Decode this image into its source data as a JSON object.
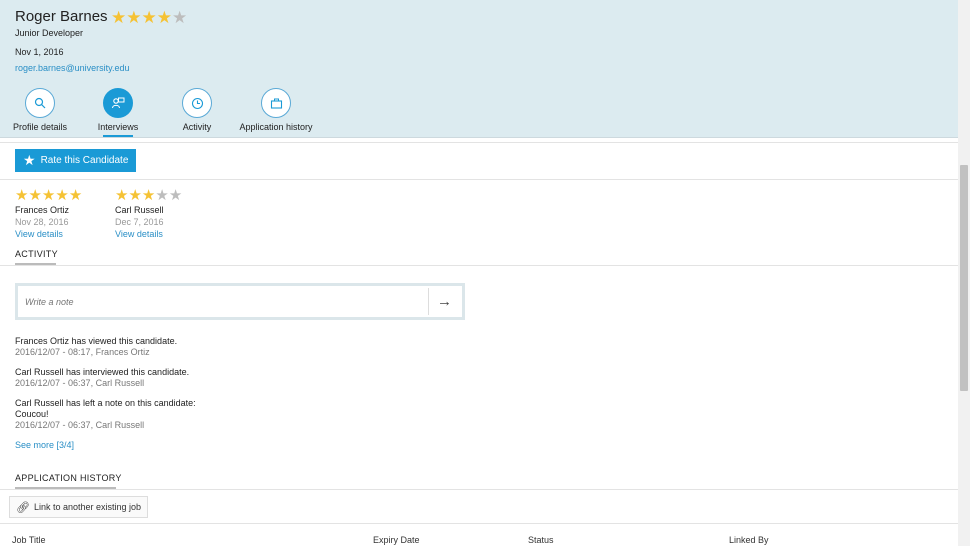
{
  "candidate": {
    "name": "Roger Barnes",
    "rating": 4,
    "role": "Junior Developer",
    "date": "Nov 1, 2016",
    "email": "roger.barnes@university.edu"
  },
  "tabs": [
    {
      "label": "Profile details",
      "icon": "search-icon"
    },
    {
      "label": "Interviews",
      "icon": "interviews-icon"
    },
    {
      "label": "Activity",
      "icon": "clock-icon"
    },
    {
      "label": "Application history",
      "icon": "briefcase-icon"
    }
  ],
  "rate_button": {
    "label": "Rate this Candidate"
  },
  "reviews": [
    {
      "name": "Frances Ortiz",
      "date": "Nov 28, 2016",
      "rating": 5,
      "link": "View details"
    },
    {
      "name": "Carl Russell",
      "date": "Dec 7, 2016",
      "rating": 3,
      "link": "View details"
    }
  ],
  "activity": {
    "title": "ACTIVITY",
    "note_placeholder": "Write a note",
    "items": [
      {
        "text": "Frances Ortiz has viewed this candidate.",
        "meta": "2016/12/07 - 08:17, Frances Ortiz"
      },
      {
        "text": "Carl Russell has interviewed this candidate.",
        "meta": "2016/12/07 - 06:37, Carl Russell"
      },
      {
        "text": "Carl Russell has left a note on this candidate:",
        "note": "Coucou!",
        "meta": "2016/12/07 - 06:37, Carl Russell"
      }
    ],
    "see_more": "See more [3/4]"
  },
  "application_history": {
    "title": "APPLICATION HISTORY",
    "link_button": "Link to another existing job",
    "columns": [
      "Job Title",
      "Expiry Date",
      "Status",
      "Linked By"
    ]
  },
  "colors": {
    "accent": "#1a9ad6",
    "star": "#f5c234",
    "star_empty": "#bdbdbd",
    "header_bg": "#dcebf0"
  }
}
